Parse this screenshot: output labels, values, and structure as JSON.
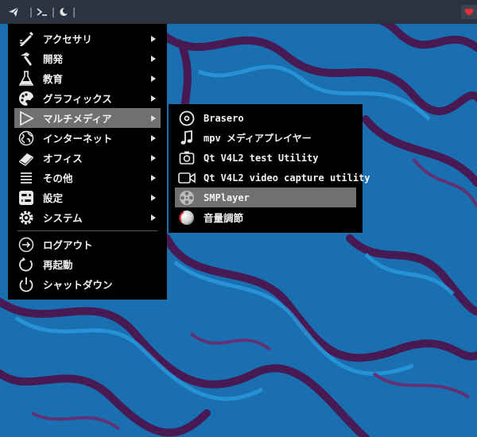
{
  "topbar": {
    "launcher_icon": "paper-plane-icon",
    "terminal_icon": "terminal-prompt-icon",
    "theme_icon": "crescent-moon-icon",
    "separators": [
      "|",
      "|",
      "|"
    ],
    "tray_icon": "heart-icon",
    "tray_color": "#e0303a"
  },
  "main_menu": {
    "items": [
      {
        "label": "アクセサリ",
        "icon": "pencil-ruler-icon",
        "submenu": true
      },
      {
        "label": "開発",
        "icon": "hammer-icon",
        "submenu": true
      },
      {
        "label": "教育",
        "icon": "flask-icon",
        "submenu": true
      },
      {
        "label": "グラフィックス",
        "icon": "palette-icon",
        "submenu": true
      },
      {
        "label": "マルチメディア",
        "icon": "play-icon",
        "submenu": true,
        "selected": true
      },
      {
        "label": "インターネット",
        "icon": "globe-icon",
        "submenu": true
      },
      {
        "label": "オフィス",
        "icon": "book-icon",
        "submenu": true
      },
      {
        "label": "その他",
        "icon": "list-icon",
        "submenu": true
      },
      {
        "label": "設定",
        "icon": "toggle-settings-icon",
        "submenu": true
      },
      {
        "label": "システム",
        "icon": "gear-icon",
        "submenu": true
      }
    ],
    "session_items": [
      {
        "label": "ログアウト",
        "icon": "logout-icon"
      },
      {
        "label": "再起動",
        "icon": "restart-icon"
      },
      {
        "label": "シャットダウン",
        "icon": "power-icon"
      }
    ]
  },
  "multimedia_menu": {
    "items": [
      {
        "label": "Brasero",
        "icon": "disc-icon"
      },
      {
        "label": "mpv メディアプレイヤー",
        "icon": "music-note-icon"
      },
      {
        "label": "Qt V4L2 test Utility",
        "icon": "camera-icon"
      },
      {
        "label": "Qt V4L2 video capture utility",
        "icon": "video-camera-icon"
      },
      {
        "label": "SMPlayer",
        "icon": "film-reel-icon",
        "selected": true
      },
      {
        "label": "音量調節",
        "icon": "volume-knob-icon"
      }
    ]
  },
  "colors": {
    "menu_bg": "#000000",
    "selection": "#707070",
    "topbar_bg": "#2b3240",
    "wallpaper_blue": "#1a6fb0",
    "wallpaper_purple": "#4a1650"
  }
}
